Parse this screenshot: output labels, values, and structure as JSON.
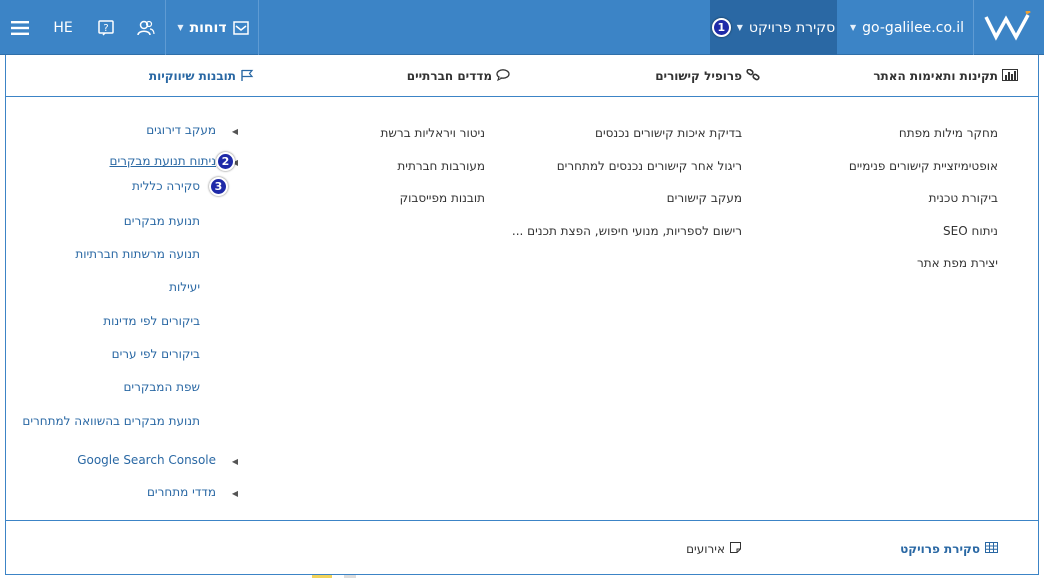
{
  "topbar": {
    "project_label": "סקירת פרויקט",
    "project_badge": "1",
    "domain_label": "go-galilee.co.il",
    "reports_label": "דוחות",
    "language_label": "HE",
    "icons": {
      "logo": "w-logo-icon",
      "menu": "hamburger-icon",
      "help": "help-icon",
      "users": "users-icon",
      "reports": "reports-icon"
    }
  },
  "columns": {
    "seo": {
      "title": "תקינות ותאימות האתר",
      "icon": "bar-chart-icon",
      "items": [
        "מחקר מילות מפתח",
        "אופטימיזציית קישורים פנימיים",
        "ביקורת טכנית",
        "ניתוח SEO",
        "יצירת מפת אתר"
      ]
    },
    "links": {
      "title": "פרופיל קישורים",
      "icon": "link-icon",
      "items": [
        "בדיקת איכות קישורים נכנסים",
        "ריגול אחר קישורים נכנסים למתחרים",
        "מעקב קישורים",
        "רישום לספריות, מנועי חיפוש, הפצת תכנים ..."
      ]
    },
    "social": {
      "title": "מדדים חברתיים",
      "icon": "speech-bubble-icon",
      "items": [
        "ניטור ויראליות ברשת",
        "מעורבות חברתית",
        "תובנות מפייסבוק"
      ]
    },
    "marketing": {
      "title": "תובנות שיווקיות",
      "icon": "flag-icon",
      "items": [
        {
          "label": "מעקב דירוגים",
          "arrow": true
        },
        {
          "label": "ניתוח תנועת מבקרים",
          "arrow": true,
          "badge": "2",
          "underline": true
        },
        {
          "label": "סקירה כללית",
          "badge": "3"
        },
        {
          "label": "תנועת מבקרים"
        },
        {
          "label": "תנועה מרשתות חברתיות"
        },
        {
          "label": "יעילות"
        },
        {
          "label": "ביקורים לפי מדינות"
        },
        {
          "label": "ביקורים לפי ערים"
        },
        {
          "label": "שפת המבקרים"
        },
        {
          "label": "תנועת מבקרים בהשוואה למתחרים"
        },
        {
          "label": "Google Search Console",
          "arrow": true
        },
        {
          "label": "מדדי מתחרים",
          "arrow": true
        }
      ]
    }
  },
  "footer": {
    "project_overview": "סקירת פרויקט",
    "events": "אירועים"
  },
  "colors": {
    "topbar": "#3c84c6",
    "topbar_active": "#2a68a4",
    "link": "#2a68a4",
    "badge": "#1f2aa8"
  }
}
